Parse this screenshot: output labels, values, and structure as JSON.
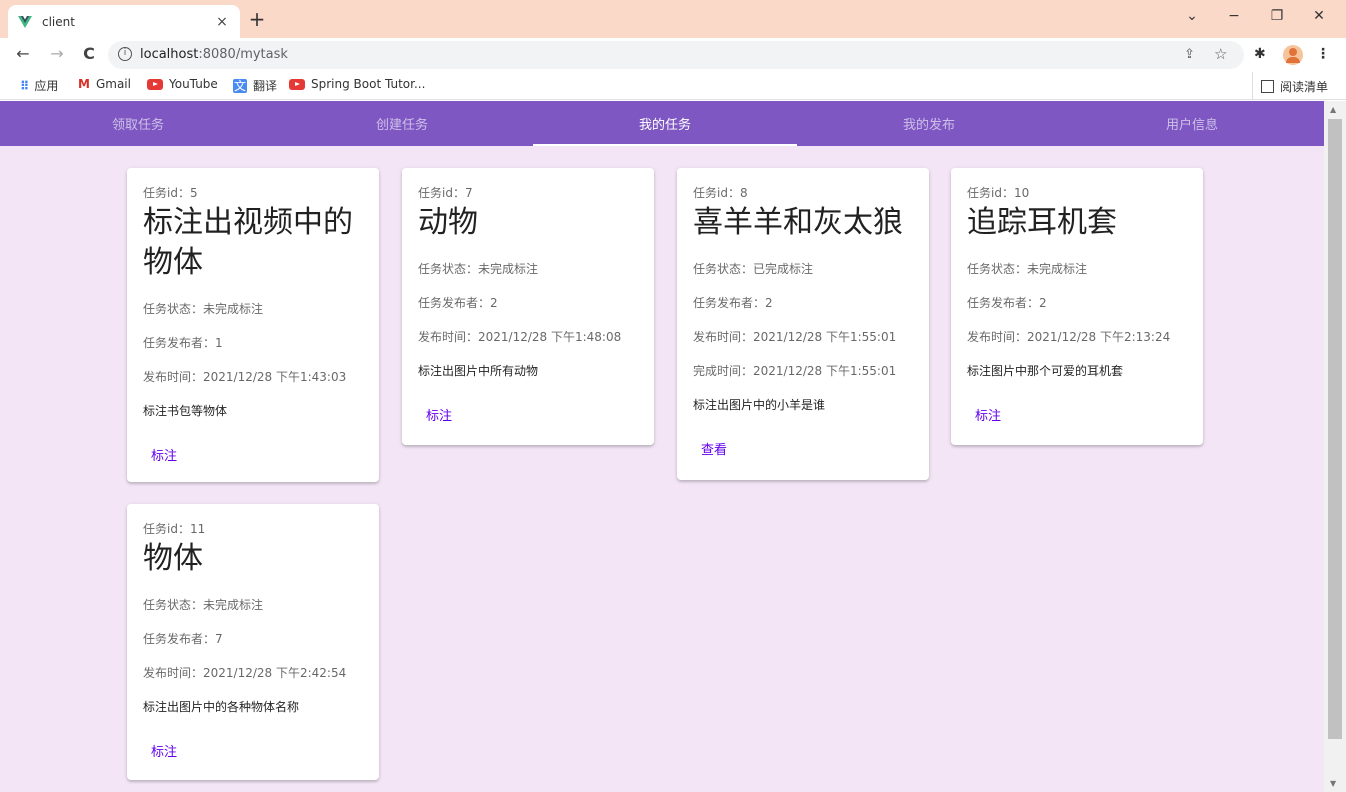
{
  "browser": {
    "tab_title": "client",
    "tab_close": "×",
    "new_tab": "+",
    "win_minimize_dropdown": "⌄",
    "win_minimize": "−",
    "win_restore": "❐",
    "win_close": "✕",
    "back": "←",
    "forward": "→",
    "reload": "C",
    "url_host": "localhost",
    "url_path": ":8080/mytask",
    "info_icon": "i",
    "share_icon": "⇪",
    "star_icon": "☆",
    "extensions_icon": "✱",
    "menu_icon": "⋮"
  },
  "bookmarks": {
    "items": [
      {
        "icon": "apps-icon",
        "glyph": "⠿",
        "label": "应用"
      },
      {
        "icon": "gmail-icon",
        "glyph": "M",
        "label": "Gmail"
      },
      {
        "icon": "youtube-icon",
        "glyph": "",
        "label": "YouTube"
      },
      {
        "icon": "translate-icon",
        "glyph": "文",
        "label": "翻译"
      },
      {
        "icon": "youtube-icon",
        "glyph": "",
        "label": "Spring Boot Tutor..."
      }
    ],
    "reading_list": "阅读清单"
  },
  "nav": {
    "tabs": [
      "领取任务",
      "创建任务",
      "我的任务",
      "我的发布",
      "用户信息"
    ],
    "active_index": 2
  },
  "cards": [
    {
      "id_label": "任务id：5",
      "title": "标注出视频中的物体",
      "status": "任务状态：未完成标注",
      "publisher": "任务发布者：1",
      "publish_time": "发布时间：2021/12/28 下午1:43:03",
      "finish_time": null,
      "description": "标注书包等物体",
      "action": "标注"
    },
    {
      "id_label": "任务id：7",
      "title": "动物",
      "status": "任务状态：未完成标注",
      "publisher": "任务发布者：2",
      "publish_time": "发布时间：2021/12/28 下午1:48:08",
      "finish_time": null,
      "description": "标注出图片中所有动物",
      "action": "标注"
    },
    {
      "id_label": "任务id：8",
      "title": "喜羊羊和灰太狼",
      "status": "任务状态：已完成标注",
      "publisher": "任务发布者：2",
      "publish_time": "发布时间：2021/12/28 下午1:55:01",
      "finish_time": "完成时间：2021/12/28 下午1:55:01",
      "description": "标注出图片中的小羊是谁",
      "action": "查看"
    },
    {
      "id_label": "任务id：10",
      "title": "追踪耳机套",
      "status": "任务状态：未完成标注",
      "publisher": "任务发布者：2",
      "publish_time": "发布时间：2021/12/28 下午2:13:24",
      "finish_time": null,
      "description": "标注图片中那个可爱的耳机套",
      "action": "标注"
    },
    {
      "id_label": "任务id：11",
      "title": "物体",
      "status": "任务状态：未完成标注",
      "publisher": "任务发布者：7",
      "publish_time": "发布时间：2021/12/28 下午2:42:54",
      "finish_time": null,
      "description": "标注出图片中的各种物体名称",
      "action": "标注"
    }
  ],
  "colors": {
    "primary": "#7e57c2",
    "background": "#f3e5f5",
    "action": "#6200ee",
    "tabstrip": "#fbd9c9"
  }
}
